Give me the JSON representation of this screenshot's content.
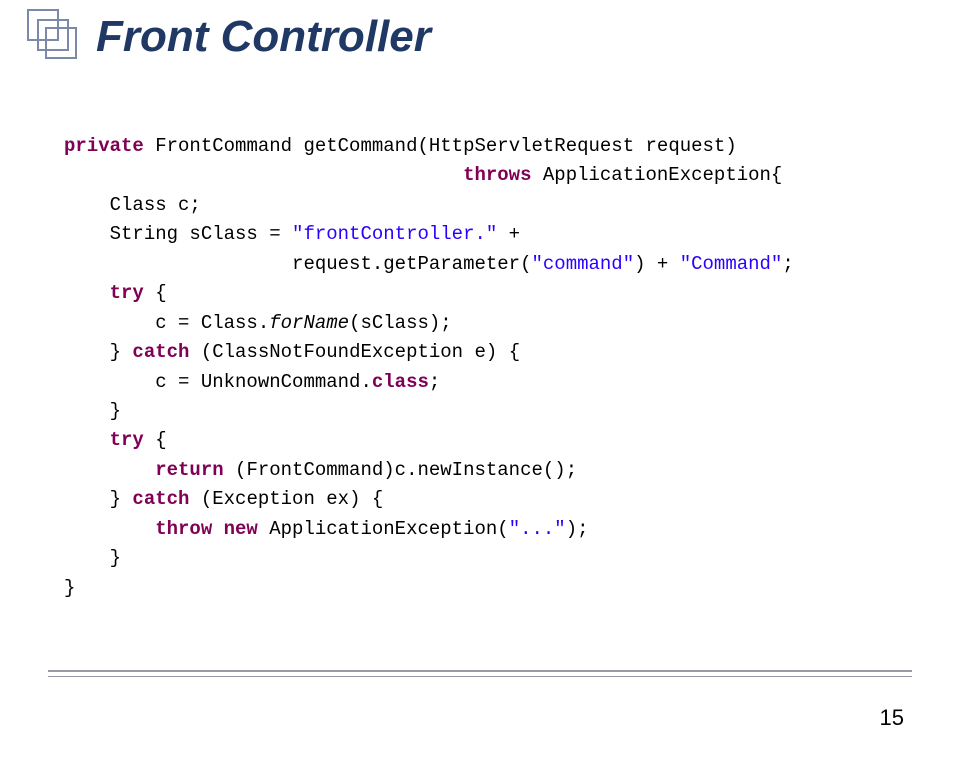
{
  "title": "Front Controller",
  "page_number": "15",
  "code": {
    "l1a": "private",
    "l1b": " FrontCommand getCommand(HttpServletRequest request)",
    "l2a": "                                   throws",
    "l2b": " ApplicationException{",
    "l3": "    Class c;",
    "l4a": "    String sClass = ",
    "l4b": "\"frontController.\"",
    "l4c": " + ",
    "l5a": "                    request.getParameter(",
    "l5b": "\"command\"",
    "l5c": ") + ",
    "l5d": "\"Command\"",
    "l5e": ";",
    "l6a": "    try",
    "l6b": " {",
    "l7a": "        c = Class.",
    "l7b": "forName",
    "l7c": "(sClass);",
    "l8a": "    } ",
    "l8b": "catch",
    "l8c": " (ClassNotFoundException e) {",
    "l9a": "        c = UnknownCommand.",
    "l9b": "class",
    "l9c": ";",
    "l10": "    }",
    "l11a": "    try",
    "l11b": " {",
    "l12a": "        return",
    "l12b": " (FrontCommand)c.newInstance();",
    "l13a": "    } ",
    "l13b": "catch",
    "l13c": " (Exception ex) {",
    "l14a": "        throw new",
    "l14b": " ApplicationException(",
    "l14c": "\"...\"",
    "l14d": ");",
    "l15": "    }",
    "l16": "}"
  }
}
